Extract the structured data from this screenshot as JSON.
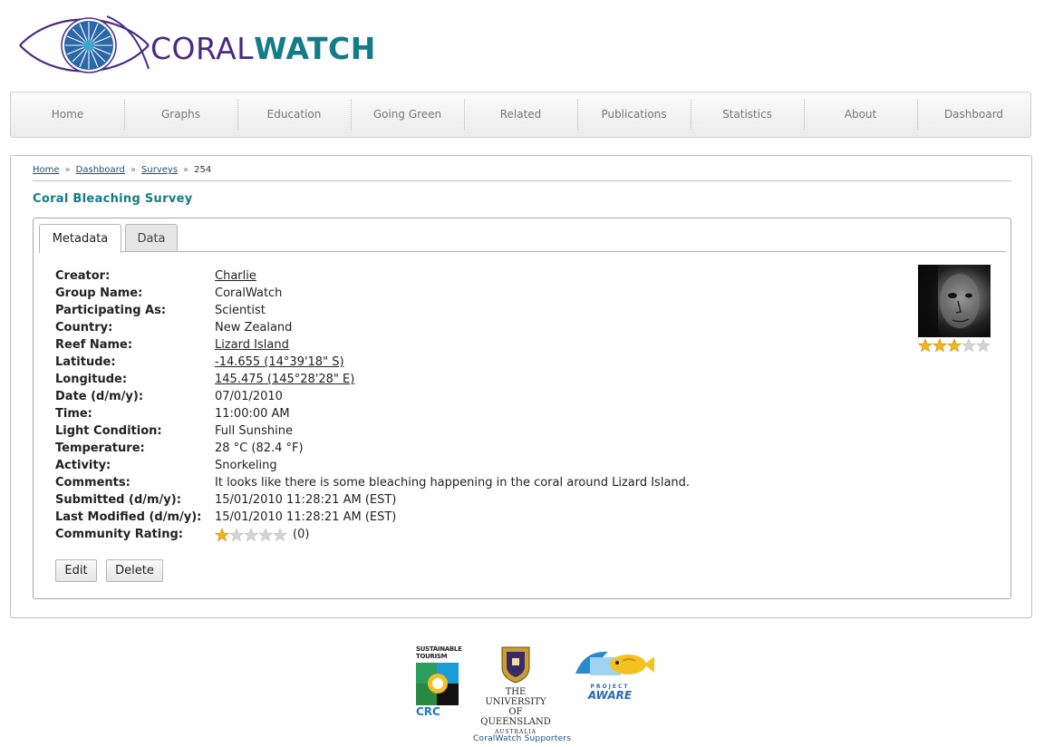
{
  "brand": {
    "name_part1": "CORAL",
    "name_part2": "WATCH",
    "color_purple": "#4a2a82",
    "color_teal": "#137c88"
  },
  "nav": {
    "items": [
      "Home",
      "Graphs",
      "Education",
      "Going Green",
      "Related",
      "Publications",
      "Statistics",
      "About",
      "Dashboard"
    ]
  },
  "breadcrumb": {
    "home": "Home",
    "dashboard": "Dashboard",
    "surveys": "Surveys",
    "current": "254",
    "separator": "»"
  },
  "page_title": "Coral Bleaching Survey",
  "tabs": {
    "metadata": "Metadata",
    "data": "Data",
    "active": "Metadata"
  },
  "fields": [
    {
      "label": "Creator:",
      "value": "Charlie",
      "link": true
    },
    {
      "label": "Group Name:",
      "value": "CoralWatch",
      "link": false
    },
    {
      "label": "Participating As:",
      "value": "Scientist",
      "link": false
    },
    {
      "label": "Country:",
      "value": "New Zealand",
      "link": false
    },
    {
      "label": "Reef Name:",
      "value": "Lizard Island",
      "link": true
    },
    {
      "label": "Latitude:",
      "value": "-14.655 (14°39'18\" S)",
      "link": true
    },
    {
      "label": "Longitude:",
      "value": "145.475 (145°28'28\" E)",
      "link": true
    },
    {
      "label": "Date (d/m/y):",
      "value": "07/01/2010",
      "link": false
    },
    {
      "label": "Time:",
      "value": "11:00:00 AM",
      "link": false
    },
    {
      "label": "Light Condition:",
      "value": "Full Sunshine",
      "link": false
    },
    {
      "label": "Temperature:",
      "value": "28 °C (82.4 °F)",
      "link": false
    },
    {
      "label": "Activity:",
      "value": "Snorkeling",
      "link": false
    },
    {
      "label": "Comments:",
      "value": "It looks like there is some bleaching happening in the coral around Lizard Island.",
      "link": false
    },
    {
      "label": "Submitted (d/m/y):",
      "value": "15/01/2010 11:28:21 AM (EST)",
      "link": false
    },
    {
      "label": "Last Modified (d/m/y):",
      "value": "15/01/2010 11:28:21 AM (EST)",
      "link": false
    }
  ],
  "community_rating": {
    "label": "Community Rating:",
    "stars_filled": 1,
    "stars_total": 5,
    "count_text": "(0)"
  },
  "user_rating": {
    "stars_filled": 3,
    "stars_total": 5
  },
  "buttons": {
    "edit": "Edit",
    "delete": "Delete"
  },
  "footer": {
    "caption": "CoralWatch Supporters",
    "sustainable_tourism": {
      "line1": "SUSTAINABLE",
      "line2": "TOURISM",
      "crc": "CRC"
    },
    "uq": {
      "line1": "THE UNIVERSITY",
      "line2": "OF QUEENSLAND",
      "line3": "AUSTRALIA"
    },
    "project_aware": {
      "line1": "PROJECT",
      "line2": "AWARE"
    }
  },
  "colors": {
    "star_gold": "#f2b51b",
    "star_grey": "#d4d4d4",
    "link_blue": "#1a4f7a"
  }
}
